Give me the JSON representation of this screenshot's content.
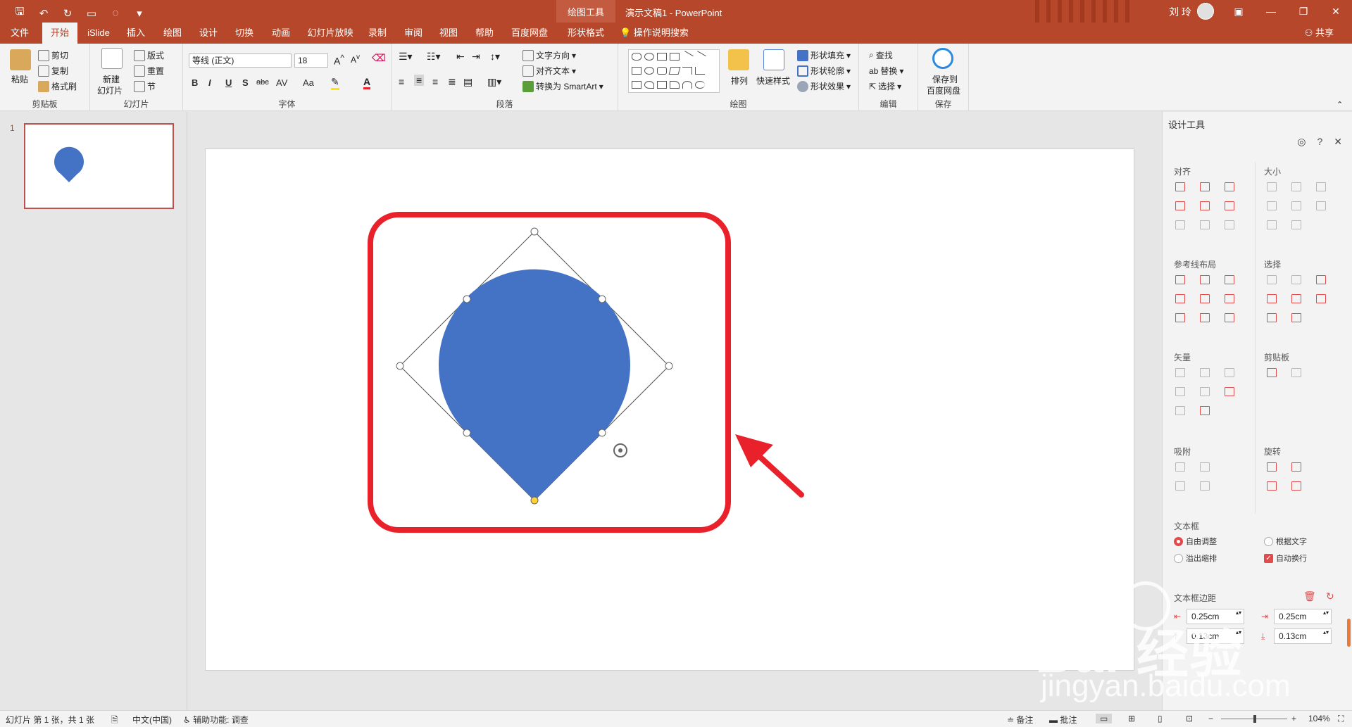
{
  "titlebar": {
    "context_tools": "绘图工具",
    "doc_title": "演示文稿1  -  PowerPoint",
    "user_name": "刘 玲",
    "accent_color": "#b7472a"
  },
  "tabs": {
    "items": [
      "文件",
      "开始",
      "iSlide",
      "插入",
      "绘图",
      "设计",
      "切换",
      "动画",
      "幻灯片放映",
      "录制",
      "审阅",
      "视图",
      "帮助",
      "百度网盘",
      "形状格式"
    ],
    "active": "开始",
    "tell_me": "操作说明搜索",
    "share": "共享"
  },
  "ribbon": {
    "clipboard": {
      "paste": "粘贴",
      "cut": "剪切",
      "copy": "复制",
      "format_painter": "格式刷",
      "label": "剪贴板"
    },
    "slides": {
      "new_slide_1": "新建",
      "new_slide_2": "幻灯片",
      "layout": "版式",
      "reset": "重置",
      "section": "节",
      "label": "幻灯片"
    },
    "font": {
      "font_name": "等线 (正文)",
      "font_size": "18",
      "bold": "B",
      "italic": "I",
      "underline": "U",
      "shadow": "S",
      "strike": "abc",
      "spacing": "AV",
      "case": "Aa",
      "label": "字体"
    },
    "paragraph": {
      "text_direction": "文字方向",
      "align_text": "对齐文本",
      "smartart": "转换为 SmartArt",
      "label": "段落"
    },
    "drawing": {
      "arrange": "排列",
      "quick_styles": "快速样式",
      "fill": "形状填充",
      "outline": "形状轮廓",
      "effects": "形状效果",
      "label": "绘图"
    },
    "editing": {
      "find": "查找",
      "replace": "替换",
      "select": "选择",
      "label": "编辑"
    },
    "save": {
      "save_1": "保存到",
      "save_2": "百度网盘",
      "label": "保存"
    }
  },
  "thumbnails": {
    "slide_number": "1"
  },
  "slide": {
    "shape_color": "#4472c4",
    "highlight_color": "#e8212a"
  },
  "design_pane": {
    "title": "设计工具",
    "sections": {
      "align": "对齐",
      "size": "大小",
      "guides": "参考线布局",
      "select": "选择",
      "vector": "矢量",
      "clipboard": "剪贴板",
      "snap": "吸附",
      "rotate": "旋转",
      "textbox": "文本框",
      "margins": "文本框边距"
    },
    "textbox_options": {
      "free_adjust": "自由调整",
      "fit_text": "根据文字",
      "overflow_shrink": "溢出缩排",
      "auto_wrap": "自动换行"
    },
    "margins": {
      "left": "0.25cm",
      "right": "0.25cm",
      "top": "0.13cm",
      "bottom": "0.13cm"
    }
  },
  "watermark": {
    "brand": "Bai 经验",
    "url": "jingyan.baidu.com"
  },
  "statusbar": {
    "slide_info": "幻灯片 第 1 张，共 1 张",
    "language": "中文(中国)",
    "accessibility": "辅助功能: 调查",
    "notes": "备注",
    "comments": "批注",
    "zoom": "104%"
  }
}
